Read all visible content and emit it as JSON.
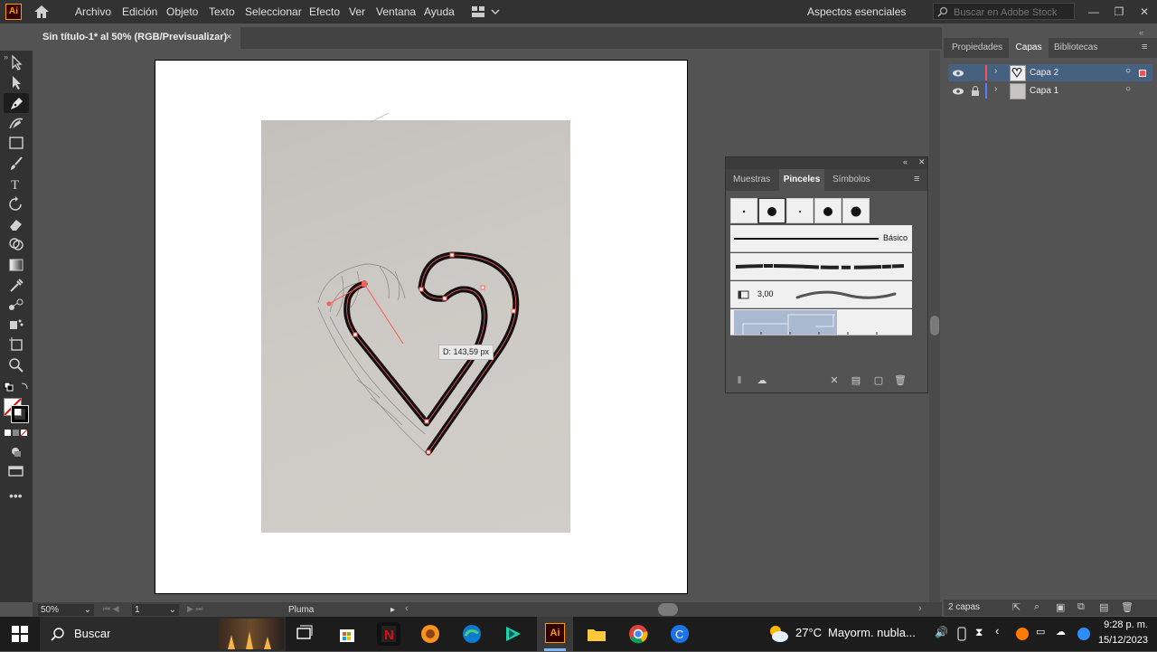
{
  "menubar": {
    "app_icon": "Ai",
    "home_icon": "home-icon",
    "items": [
      "Archivo",
      "Edición",
      "Objeto",
      "Texto",
      "Seleccionar",
      "Efecto",
      "Ver",
      "Ventana",
      "Ayuda"
    ],
    "workspace": "Aspectos esenciales",
    "search_placeholder": "Buscar en Adobe Stock"
  },
  "document_tab": {
    "title": "Sin título-1* al 50% (RGB/Previsualizar)",
    "close": "×"
  },
  "canvas": {
    "measure_label": "D: 143,59 px"
  },
  "status": {
    "zoom": "50%",
    "artboard": "1",
    "tool": "Pluma"
  },
  "brushes_panel": {
    "tabs": [
      "Muestras",
      "Pinceles",
      "Símbolos"
    ],
    "active_tab": "Pinceles",
    "basic_label": "Básico",
    "stroke_value": "3,00"
  },
  "layers_panel": {
    "tabs": [
      "Propiedades",
      "Capas",
      "Bibliotecas"
    ],
    "active_tab": "Capas",
    "layers": [
      {
        "name": "Capa 2",
        "color": "#ff4d4d",
        "selected": true
      },
      {
        "name": "Capa 1",
        "color": "#4d7fff",
        "selected": false
      }
    ],
    "count": "2 capas"
  },
  "taskbar": {
    "search": "Buscar",
    "weather_temp": "27°C",
    "weather_text": "Mayorm. nubla...",
    "time": "9:28 p. m.",
    "date": "15/12/2023"
  },
  "colors": {
    "accent": "#ff9a00",
    "selection": "#46607f",
    "path": "#ff5a5a"
  }
}
